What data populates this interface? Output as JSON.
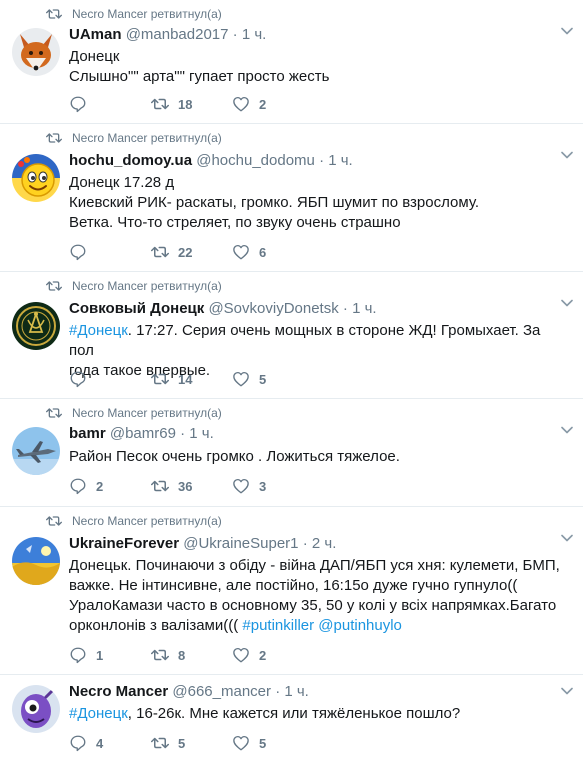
{
  "tweets": [
    {
      "retweeted_by": "Necro Mancer ретвитнул(а)",
      "name": "UAman",
      "handle": "@manbad2017",
      "time": "1 ч.",
      "lines": [
        "Донецк",
        "Слышно\"\" арта\"\" гупает просто жесть"
      ],
      "replies": "",
      "retweets": "18",
      "likes": "2"
    },
    {
      "retweeted_by": "Necro Mancer ретвитнул(а)",
      "name": "hochu_domoy.ua",
      "handle": "@hochu_dodomu",
      "time": "1 ч.",
      "lines": [
        "Донецк 17.28 д",
        "Киевский РИК- раскаты, громко. ЯБП шумит по взрослому.",
        "Ветка. Что-то стреляет, по звуку очень страшно"
      ],
      "replies": "",
      "retweets": "22",
      "likes": "6"
    },
    {
      "retweeted_by": "Necro Mancer ретвитнул(а)",
      "name": "Совковый Донецк",
      "handle": "@SovkoviyDonetsk",
      "time": "1 ч.",
      "hashtag": "#Донецк",
      "lines": [
        ". 17:27. Серия очень мощных в стороне ЖД! Громыхает. За пол",
        "года такое впервые."
      ],
      "replies": "",
      "retweets": "14",
      "likes": "5"
    },
    {
      "retweeted_by": "Necro Mancer ретвитнул(а)",
      "name": "bamr",
      "handle": "@bamr69",
      "time": "1 ч.",
      "lines": [
        "Район Песок очень громко . Ложиться тяжелое."
      ],
      "replies": "2",
      "retweets": "36",
      "likes": "3"
    },
    {
      "retweeted_by": "Necro Mancer ретвитнул(а)",
      "name": "UkraineForever",
      "handle": "@UkraineSuper1",
      "time": "2 ч.",
      "lines": [
        "Донецьк. Починаючи з обіду - війна ДАП/ЯБП уся хня: кулемети, БМП,",
        "важке. Не інтинсивне, але постійно, 16:15о дуже гучно гупнуло((",
        "УралоКамази часто в основному 35, 50 у колі у всіх напрямках.Багато"
      ],
      "last_line_prefix": "орконлонів з валізами((( ",
      "last_line_tags": "#putinkiller @putinhuylo",
      "replies": "1",
      "retweets": "8",
      "likes": "2"
    },
    {
      "retweeted_by": "",
      "name": "Necro Mancer",
      "handle": "@666_mancer",
      "time": "1 ч.",
      "hashtag": "#Донецк",
      "lines": [
        ", 16-26к. Мне кажется или тяжёленькое пошло?"
      ],
      "replies": "4",
      "retweets": "5",
      "likes": "5"
    }
  ],
  "colors": {
    "text": "#14171a",
    "muted": "#657786",
    "link": "#1b95e0",
    "divider": "#e6ecf0"
  }
}
